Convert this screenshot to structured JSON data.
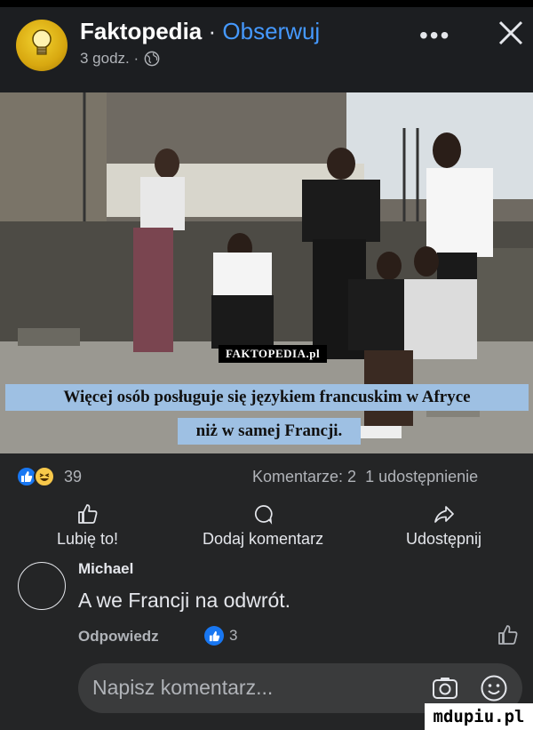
{
  "post": {
    "page_name": "Faktopedia",
    "separator": "·",
    "follow_label": "Obserwuj",
    "time": "3 godz. ·",
    "more_icon": "more-dots-icon",
    "close_icon": "close-icon"
  },
  "image": {
    "brand_caption": "FAKTOPEDIA.pl",
    "caption_line1": "Więcej osób posługuje się językiem francuskim w Afryce",
    "caption_line2": "niż w samej Francji."
  },
  "stats": {
    "reaction_count": "39",
    "comments": "Komentarze: 2",
    "shares": "1 udostępnienie"
  },
  "actions": {
    "like": "Lubię to!",
    "comment": "Dodaj komentarz",
    "share": "Udostępnij"
  },
  "comment": {
    "author": "Michael",
    "text": "A we Francji na odwrót.",
    "reply": "Odpowiedz",
    "likes": "3"
  },
  "composer": {
    "placeholder": "Napisz komentarz..."
  },
  "watermark": "mdupiu.pl",
  "colors": {
    "accent": "#4599ff",
    "like_blue": "#1877f2",
    "caption_bg": "#9ec0e3",
    "panel_bg": "#242526"
  }
}
